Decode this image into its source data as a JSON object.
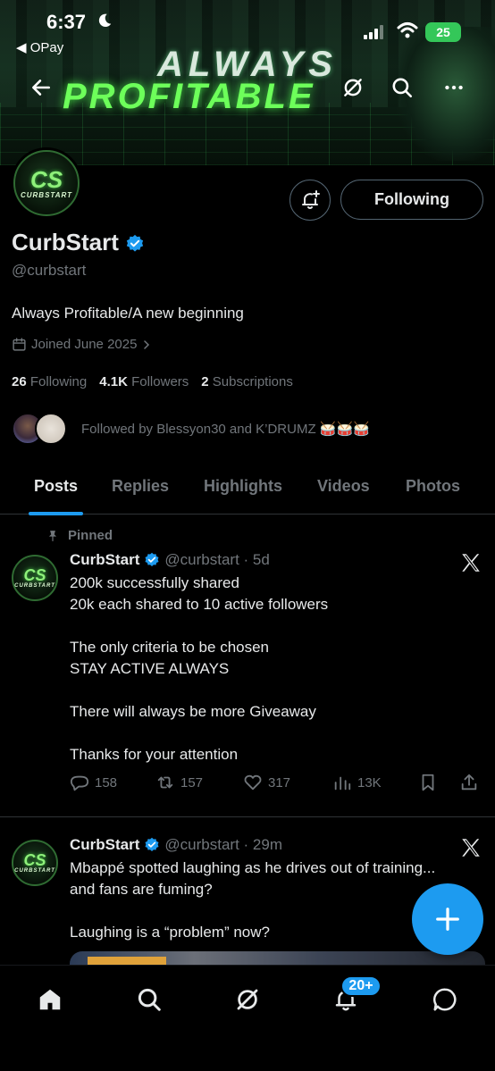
{
  "status_bar": {
    "time": "6:37",
    "back_app": "◀ OPay",
    "battery": "25"
  },
  "banner": {
    "line1": "ALWAYS",
    "line2": "PROFITABLE"
  },
  "profile": {
    "avatar_logo": "CS",
    "avatar_text": "CURBSTART",
    "name": "CurbStart",
    "handle": "@curbstart",
    "bio": "Always Profitable/A new beginning",
    "joined": "Joined June 2025",
    "following_button": "Following",
    "stats": {
      "following_count": "26",
      "following_label": "Following",
      "followers_count": "4.1K",
      "followers_label": "Followers",
      "subscriptions_count": "2",
      "subscriptions_label": "Subscriptions"
    },
    "followed_by": "Followed by Blessyon30 and K’DRUMZ 🥁🥁🥁"
  },
  "tabs": [
    "Posts",
    "Replies",
    "Highlights",
    "Videos",
    "Photos"
  ],
  "posts": [
    {
      "pinned_label": "Pinned",
      "name": "CurbStart",
      "handle_time": "@curbstart · 5d",
      "paragraphs": [
        "200k successfully shared\n20k each shared to 10 active followers",
        "The only criteria to be chosen\nSTAY ACTIVE ALWAYS",
        "There will always be more Giveaway",
        "Thanks for your attention"
      ],
      "replies": "158",
      "reposts": "157",
      "likes": "317",
      "views": "13K"
    },
    {
      "name": "CurbStart",
      "handle_time": "@curbstart · 29m",
      "paragraphs": [
        "Mbappé spotted laughing as he drives out of training...\nand fans are fuming?",
        "Laughing is a “problem” now?"
      ]
    }
  ],
  "nav": {
    "notifications_badge": "20+"
  },
  "colors": {
    "accent": "#1d9bf0",
    "muted": "#71767b",
    "text": "#e7e9ea",
    "banner_green": "#6dff5a"
  }
}
